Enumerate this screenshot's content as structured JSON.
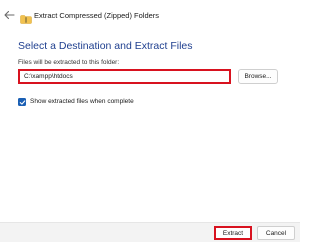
{
  "window": {
    "title": "Extract Compressed (Zipped) Folders",
    "back_icon": "back-arrow-icon",
    "folder_icon": "zip-folder-icon"
  },
  "main": {
    "heading": "Select a Destination and Extract Files",
    "field_label": "Files will be extracted to this folder:",
    "path_value": "C:\\xampp\\htdocs",
    "browse_label": "Browse...",
    "checkbox": {
      "label": "Show extracted files when complete",
      "checked": true,
      "icon": "check-icon"
    }
  },
  "footer": {
    "extract_label": "Extract",
    "cancel_label": "Cancel"
  },
  "colors": {
    "heading": "#1f3f8f",
    "accent": "#1a5fb4",
    "highlight": "#d8121f",
    "footer_bg": "#f3f3f3"
  }
}
